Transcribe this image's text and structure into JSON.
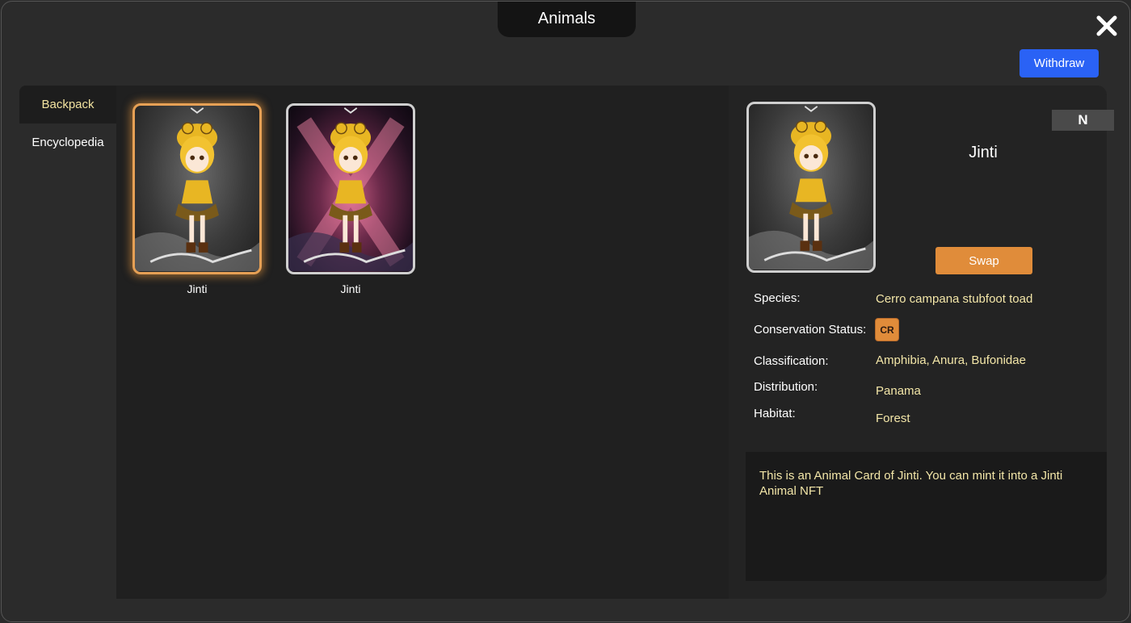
{
  "window": {
    "title": "Animals"
  },
  "header": {
    "withdraw_label": "Withdraw",
    "close_icon": "close-icon"
  },
  "tabs": [
    {
      "label": "Backpack",
      "active": true
    },
    {
      "label": "Encyclopedia",
      "active": false
    }
  ],
  "cards": [
    {
      "name": "Jinti",
      "selected": true,
      "background": "gray"
    },
    {
      "name": "Jinti",
      "selected": false,
      "background": "space"
    }
  ],
  "details": {
    "name": "Jinti",
    "rarity": "N",
    "swap_label": "Swap",
    "species_label": "Species:",
    "species_value": "Cerro campana stubfoot toad",
    "conservation_label": "Conservation Status:",
    "conservation_value": "CR",
    "classification_label": "Classification:",
    "classification_value": "Amphibia, Anura, Bufonidae",
    "distribution_label": "Distribution:",
    "distribution_value": "Panama",
    "habitat_label": "Habitat:",
    "habitat_value": "Forest",
    "description": "This is an Animal Card of Jinti. You can mint it into a Jinti Animal NFT"
  },
  "colors": {
    "accent_blue": "#2a62f5",
    "swap_orange": "#e08c3a",
    "value_yellow": "#f3e6a8",
    "selected_border": "#e6a055"
  }
}
